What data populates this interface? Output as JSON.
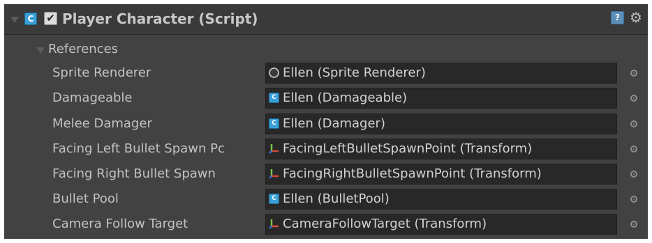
{
  "component": {
    "title": "Player Character (Script)",
    "enabled": true,
    "script_icon": "script-icon",
    "check_glyph": "✔",
    "help_glyph": "?",
    "gear_glyph": "⚙"
  },
  "section": {
    "label": "References",
    "expanded": true
  },
  "properties": [
    {
      "label": "Sprite Renderer",
      "value": "Ellen (Sprite Renderer)",
      "icon": "sprite-renderer-icon"
    },
    {
      "label": "Damageable",
      "value": "Ellen (Damageable)",
      "icon": "script-icon"
    },
    {
      "label": "Melee Damager",
      "value": "Ellen (Damager)",
      "icon": "script-icon"
    },
    {
      "label": "Facing Left Bullet Spawn Pc",
      "value": "FacingLeftBulletSpawnPoint (Transform)",
      "icon": "transform-icon"
    },
    {
      "label": "Facing Right Bullet Spawn",
      "value": "FacingRightBulletSpawnPoint (Transform)",
      "icon": "transform-icon"
    },
    {
      "label": "Bullet Pool",
      "value": "Ellen (BulletPool)",
      "icon": "script-icon"
    },
    {
      "label": "Camera Follow Target",
      "value": "CameraFollowTarget (Transform)",
      "icon": "transform-icon"
    }
  ],
  "colors": {
    "panel_bg": "#424242",
    "header_bg": "#3a3a3a",
    "field_bg": "#282828",
    "text": "#c2c2c2",
    "script_icon": "#3aa0d8"
  }
}
